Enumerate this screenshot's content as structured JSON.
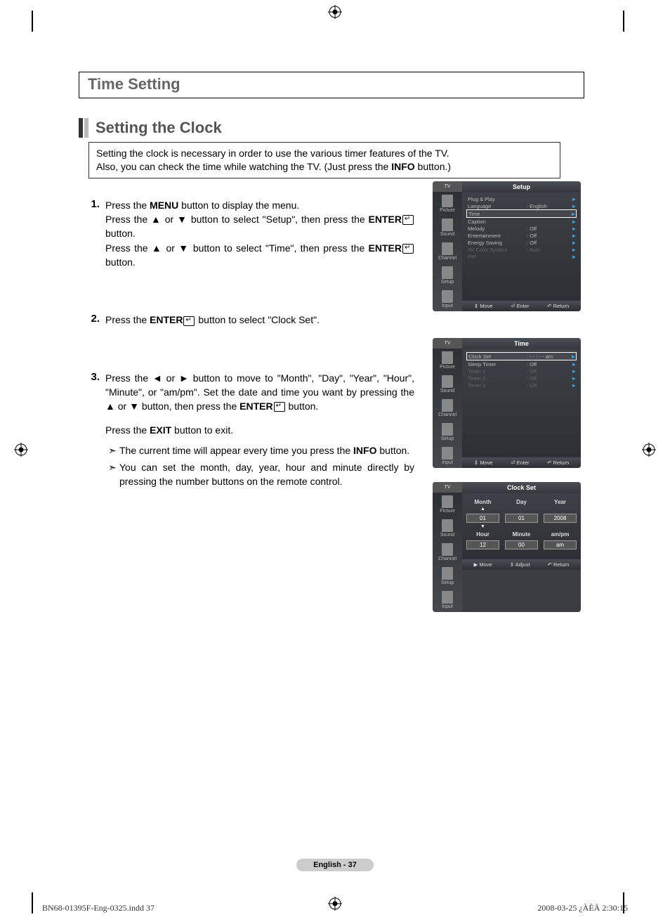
{
  "header": {
    "title": "Time Setting"
  },
  "section": {
    "title": "Setting the Clock",
    "intro_line1": "Setting the clock is necessary in order to use the various timer features of the TV.",
    "intro_line2_a": "Also, you can check the time while watching the TV. (Just press the ",
    "intro_bold": "INFO",
    "intro_line2_b": " button.)"
  },
  "steps": [
    {
      "num": "1.",
      "parts": [
        {
          "t": "Press the "
        },
        {
          "b": "MENU"
        },
        {
          "t": " button to display the menu."
        },
        {
          "br": true
        },
        {
          "t": "Press the ▲ or ▼ button to select \"Setup\", then press the "
        },
        {
          "b": "ENTER"
        },
        {
          "icon": true
        },
        {
          "t": " button."
        },
        {
          "br": true
        },
        {
          "t": "Press the ▲ or ▼ button to select \"Time\", then press the "
        },
        {
          "b": "ENTER"
        },
        {
          "icon": true
        },
        {
          "t": " button."
        }
      ]
    },
    {
      "num": "2.",
      "parts": [
        {
          "t": "Press the "
        },
        {
          "b": "ENTER"
        },
        {
          "icon": true
        },
        {
          "t": " button to select \"Clock Set\"."
        }
      ]
    },
    {
      "num": "3.",
      "parts": [
        {
          "t": "Press the ◄ or ► button to move to \"Month\", \"Day\", \"Year\", \"Hour\", \"Minute\", or \"am/pm\". Set the date and time you want by pressing the ▲ or ▼ button, then press the "
        },
        {
          "b": "ENTER"
        },
        {
          "icon": true
        },
        {
          "t": " button."
        }
      ],
      "after": [
        {
          "t": "Press the "
        },
        {
          "b": "EXIT"
        },
        {
          "t": " button to exit."
        }
      ],
      "bullets": [
        [
          {
            "t": "The current time will appear every time you press the "
          },
          {
            "b": "INFO"
          },
          {
            "t": " button."
          }
        ],
        [
          {
            "t": "You can set the month, day, year, hour and minute directly by pressing the number buttons on the remote control."
          }
        ]
      ]
    }
  ],
  "osd": {
    "tv_label": "TV",
    "side": [
      "Picture",
      "Sound",
      "Channel",
      "Setup",
      "Input"
    ],
    "screens": [
      {
        "title": "Setup",
        "rows": [
          {
            "l": "Plug & Play",
            "v": "",
            "a": "►"
          },
          {
            "l": "Language",
            "v": ": English",
            "a": "►"
          },
          {
            "l": "Time",
            "v": "",
            "a": "►",
            "hl": true
          },
          {
            "l": "Caption",
            "v": "",
            "a": "►"
          },
          {
            "l": "Melody",
            "v": ": Off",
            "a": "►"
          },
          {
            "l": "Entertainment",
            "v": ": Off",
            "a": "►"
          },
          {
            "l": "Energy Saving",
            "v": ": Off",
            "a": "►"
          },
          {
            "l": "AV Color System",
            "v": ": Auto",
            "a": "►",
            "dim": true
          },
          {
            "l": "PIP",
            "v": "",
            "a": "►",
            "dim": true
          }
        ],
        "foot": [
          "⇕ Move",
          "⏎ Enter",
          "↶ Return"
        ]
      },
      {
        "title": "Time",
        "rows": [
          {
            "l": "Clock Set",
            "v": ": - - : - - am",
            "a": "►",
            "hl": true
          },
          {
            "l": "Sleep Timer",
            "v": ": Off",
            "a": "►"
          },
          {
            "l": "Timer 1",
            "v": ": Off",
            "a": "►",
            "dim": true
          },
          {
            "l": "Timer 2",
            "v": ": Off",
            "a": "►",
            "dim": true
          },
          {
            "l": "Timer 3",
            "v": ": Off",
            "a": "►",
            "dim": true
          }
        ],
        "foot": [
          "⇕ Move",
          "⏎ Enter",
          "↶ Return"
        ]
      },
      {
        "title": "Clock Set",
        "clock": {
          "labels": [
            "Month",
            "Day",
            "Year",
            "Hour",
            "Minute",
            "am/pm"
          ],
          "values": [
            "01",
            "01",
            "2008",
            "12",
            "00",
            "am"
          ]
        },
        "foot": [
          "▶ Move",
          "⇕ Adjust",
          "↶ Return"
        ]
      }
    ]
  },
  "page_footer": {
    "page": "English - 37",
    "file": "BN68-01395F-Eng-0325.indd   37",
    "datetime": "2008-03-25   ¿ÀÈÄ 2:30:15"
  }
}
